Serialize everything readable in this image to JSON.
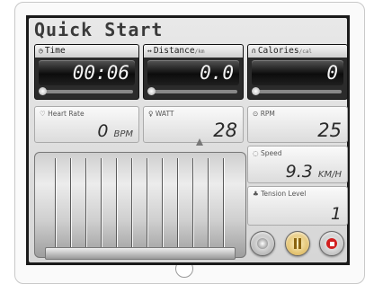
{
  "title": "Quick Start",
  "time": {
    "icon": "clock-icon",
    "label": "Time",
    "value": "00:06"
  },
  "distance": {
    "icon": "distance-icon",
    "label": "Distance",
    "unit": "/km",
    "value": "0.0"
  },
  "calories": {
    "icon": "flame-icon",
    "label": "Calories",
    "unit": "/cal",
    "value": "0"
  },
  "heart_rate": {
    "icon": "heart-icon",
    "label": "Heart Rate",
    "value": "0",
    "unit": "BPM"
  },
  "watt": {
    "icon": "bulb-icon",
    "label": "WATT",
    "value": "28"
  },
  "rpm": {
    "icon": "gauge-icon",
    "label": "RPM",
    "value": "25"
  },
  "speed": {
    "icon": "speed-icon",
    "label": "Speed",
    "value": "9.3",
    "unit": "KM/H"
  },
  "tension": {
    "icon": "tension-icon",
    "label": "Tension Level",
    "value": "1"
  },
  "buttons": {
    "left": "reset-button",
    "pause": "pause-button",
    "stop": "stop-button"
  }
}
